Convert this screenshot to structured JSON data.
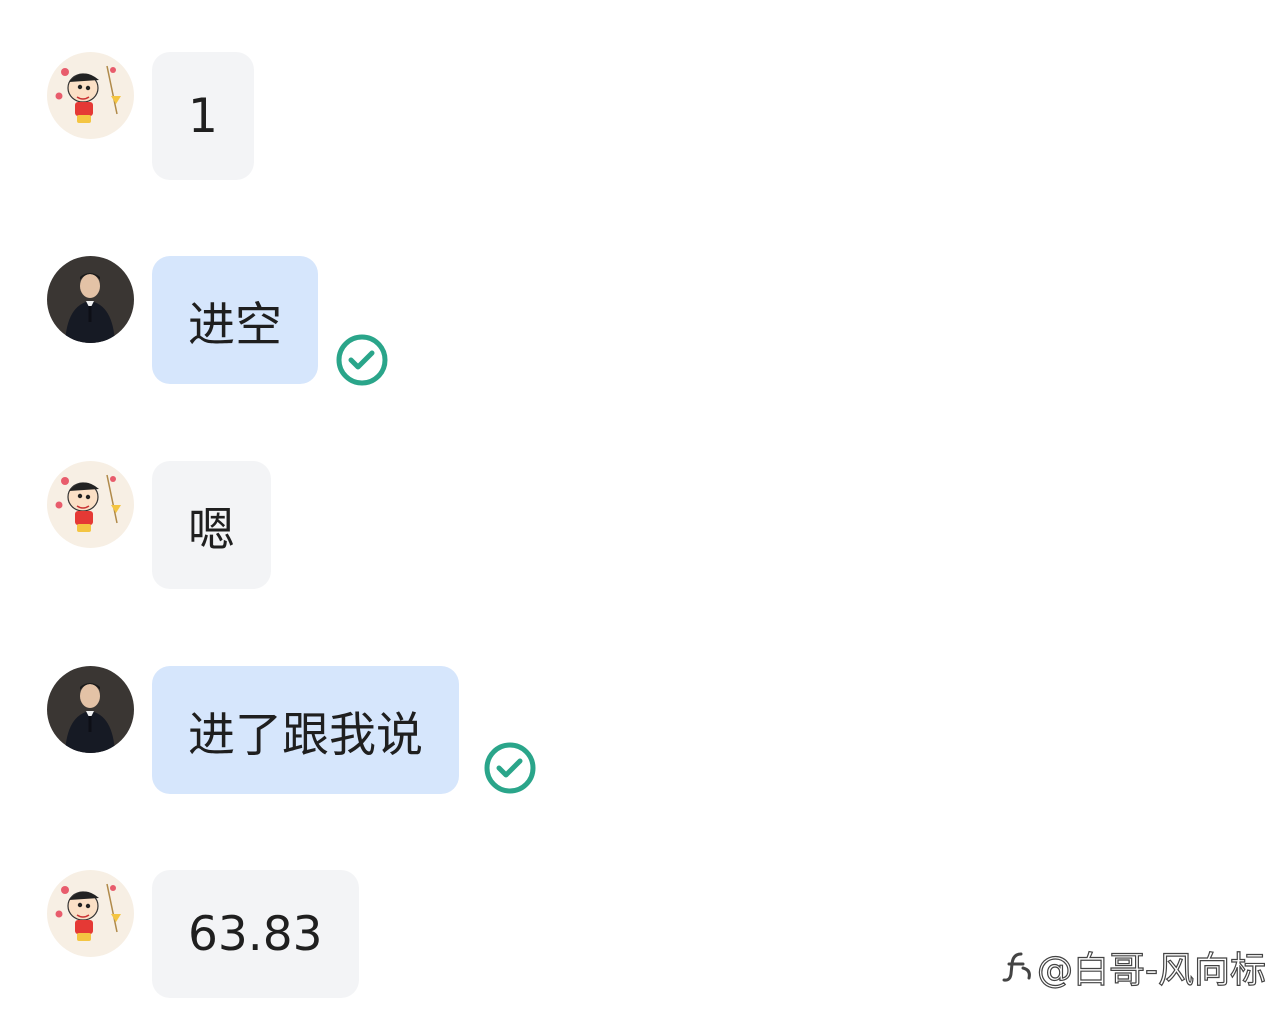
{
  "messages": [
    {
      "sender": "other",
      "text": "1",
      "read": false
    },
    {
      "sender": "me",
      "text": "进空",
      "read": true
    },
    {
      "sender": "other",
      "text": "嗯",
      "read": false
    },
    {
      "sender": "me",
      "text": "进了跟我说",
      "read": true
    },
    {
      "sender": "other",
      "text": "63.83",
      "read": false
    }
  ],
  "watermark": {
    "text": "@白哥-风向标",
    "icon": "platform-logo-icon"
  },
  "colors": {
    "other_bubble": "#f3f4f6",
    "my_bubble": "#d6e6fc",
    "read_check": "#2aa58a",
    "background": "#ffffff"
  },
  "icons": {
    "read_receipt": "check-circle-icon",
    "other_avatar": "cartoon-avatar-icon",
    "my_avatar": "suit-man-avatar-icon"
  }
}
